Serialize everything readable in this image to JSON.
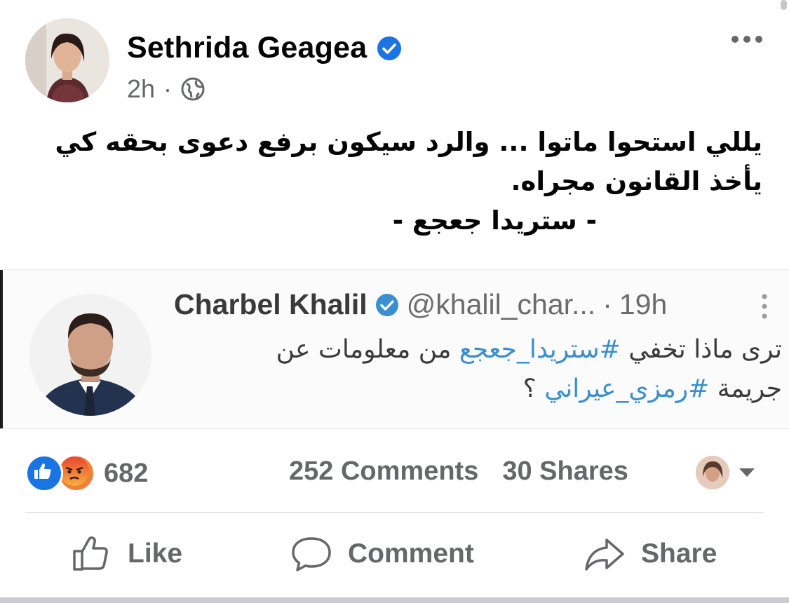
{
  "post": {
    "author": "Sethrida Geagea",
    "timestamp": "2h",
    "separator": "·",
    "text_line1": "يللي استحوا ماتوا ... والرد سيكون برفع دعوى بحقه كي",
    "text_line2": "يأخذ القانون مجراه.",
    "text_line3": "- ستريدا جعجع -"
  },
  "tweet": {
    "name": "Charbel Khalil",
    "handle": "@khalil_char...",
    "separator": "·",
    "time": "19h",
    "line1_before": "ترى ماذا تخفي ",
    "line1_hashtag": "#ستريدا_جعجع",
    "line1_after": " من معلومات عن",
    "line2_before": "جريمة ",
    "line2_hashtag": "#رمزي_عيراني",
    "line2_after": " ؟"
  },
  "stats": {
    "reactions_count": "682",
    "comments": "252 Comments",
    "shares": "30 Shares"
  },
  "actions": {
    "like": "Like",
    "comment": "Comment",
    "share": "Share"
  },
  "colors": {
    "verified_blue": "#1b74e4",
    "hashtag_blue": "#3a8fcf",
    "meta_gray": "#65676b"
  }
}
